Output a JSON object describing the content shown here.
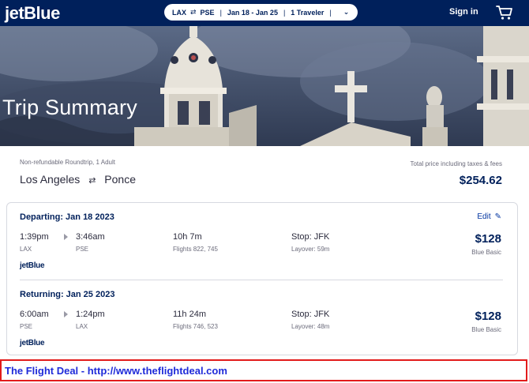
{
  "header": {
    "logo": "jetBlue",
    "search": {
      "origin": "LAX",
      "destination": "PSE",
      "swap_icon": "swap-arrows-icon",
      "dates": "Jan 18 - Jan 25",
      "travelers": "1 Traveler",
      "dropdown_icon": "chevron-down-icon"
    },
    "signin_label": "Sign in",
    "cart_icon": "shopping-cart-icon"
  },
  "hero": {
    "title": "Trip Summary"
  },
  "summary": {
    "fare_note": "Non-refundable Roundtrip, 1 Adult",
    "origin_city": "Los Angeles",
    "destination_city": "Ponce",
    "total_note": "Total price including taxes & fees",
    "total_price": "$254.62"
  },
  "legs": [
    {
      "title": "Departing: Jan 18 2023",
      "edit_label": "Edit",
      "depart_time": "1:39pm",
      "depart_code": "LAX",
      "arrive_time": "3:46am",
      "arrive_code": "PSE",
      "duration": "10h 7m",
      "flights": "Flights 822, 745",
      "stop": "Stop: JFK",
      "layover": "Layover: 59m",
      "price": "$128",
      "fare_class": "Blue Basic",
      "carrier": "jetBlue"
    },
    {
      "title": "Returning: Jan 25 2023",
      "depart_time": "6:00am",
      "depart_code": "PSE",
      "arrive_time": "1:24pm",
      "arrive_code": "LAX",
      "duration": "11h 24m",
      "flights": "Flights 746, 523",
      "stop": "Stop: JFK",
      "layover": "Layover: 48m",
      "price": "$128",
      "fare_class": "Blue Basic",
      "carrier": "jetBlue"
    }
  ],
  "watermark": {
    "text": "The Flight Deal - http://www.theflightdeal.com"
  },
  "colors": {
    "brand_navy": "#00205b",
    "link_blue": "#0033a0",
    "watermark_blue": "#1f2bd9",
    "watermark_border": "#e21b1b"
  }
}
